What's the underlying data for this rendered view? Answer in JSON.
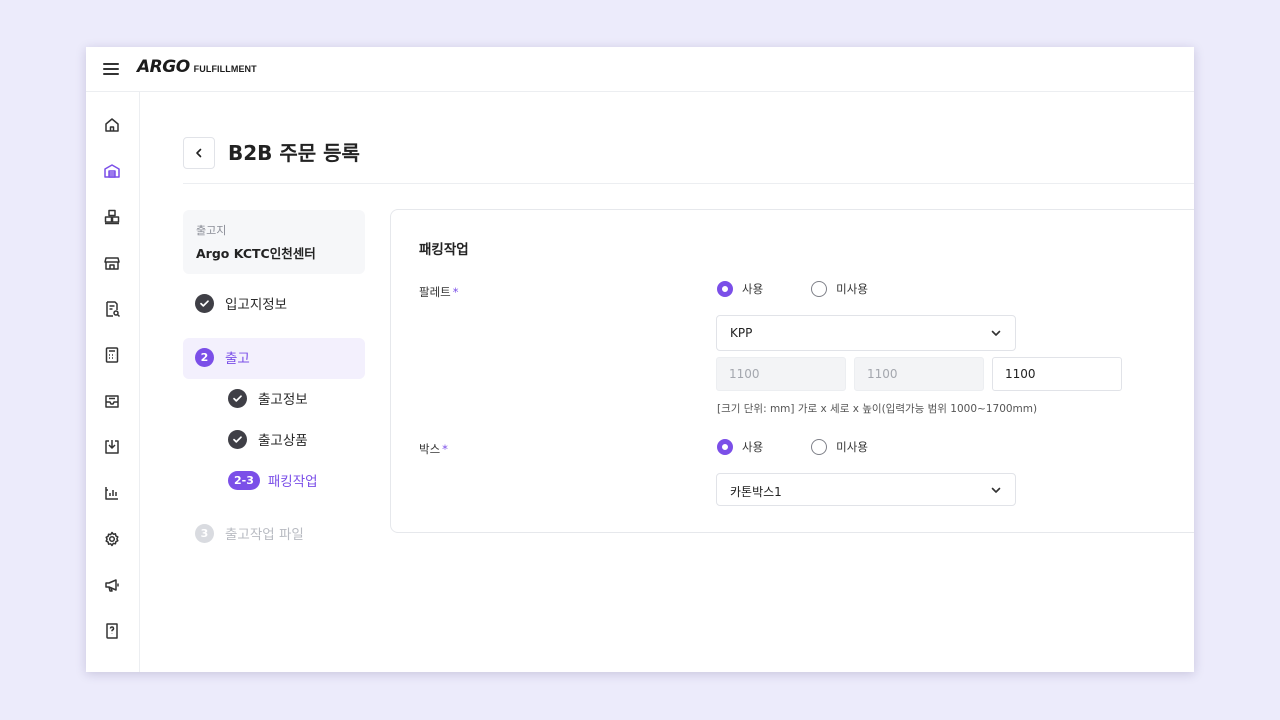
{
  "app": {
    "logo_mark": "ARGO",
    "logo_sub": "FULFILLMENT"
  },
  "sidebar": {
    "icons": [
      "home-icon",
      "warehouse-icon",
      "inventory-icon",
      "store-icon",
      "document-search-icon",
      "calculator-icon",
      "inbox-icon",
      "download-icon",
      "chart-icon",
      "gear-icon",
      "megaphone-icon",
      "help-book-icon"
    ],
    "active": "warehouse-icon",
    "accent": "#7b4fe8"
  },
  "page": {
    "title": "B2B 주문 등록"
  },
  "steps": {
    "origin_label": "출고지",
    "origin_value": "Argo KCTC인천센터",
    "step1": "입고지정보",
    "step2_num": "2",
    "step2": "출고",
    "sub1": "출고정보",
    "sub2": "출고상품",
    "sub3_num": "2-3",
    "sub3": "패킹작업",
    "step3_num": "3",
    "step3": "출고작업 파일"
  },
  "form": {
    "section_title": "패킹작업",
    "pallet": {
      "label": "팔레트",
      "required": "*",
      "option_use": "사용",
      "option_nouse": "미사용",
      "selected": "사용",
      "select_value": "KPP",
      "width_value": "1100",
      "depth_value": "1100",
      "height_value": "1100",
      "hint": "[크기 단위: mm] 가로 x 세로 x 높이(입력가능 범위 1000~1700mm)"
    },
    "box": {
      "label": "박스",
      "required": "*",
      "option_use": "사용",
      "option_nouse": "미사용",
      "selected": "사용",
      "select_value": "카톤박스1"
    }
  }
}
